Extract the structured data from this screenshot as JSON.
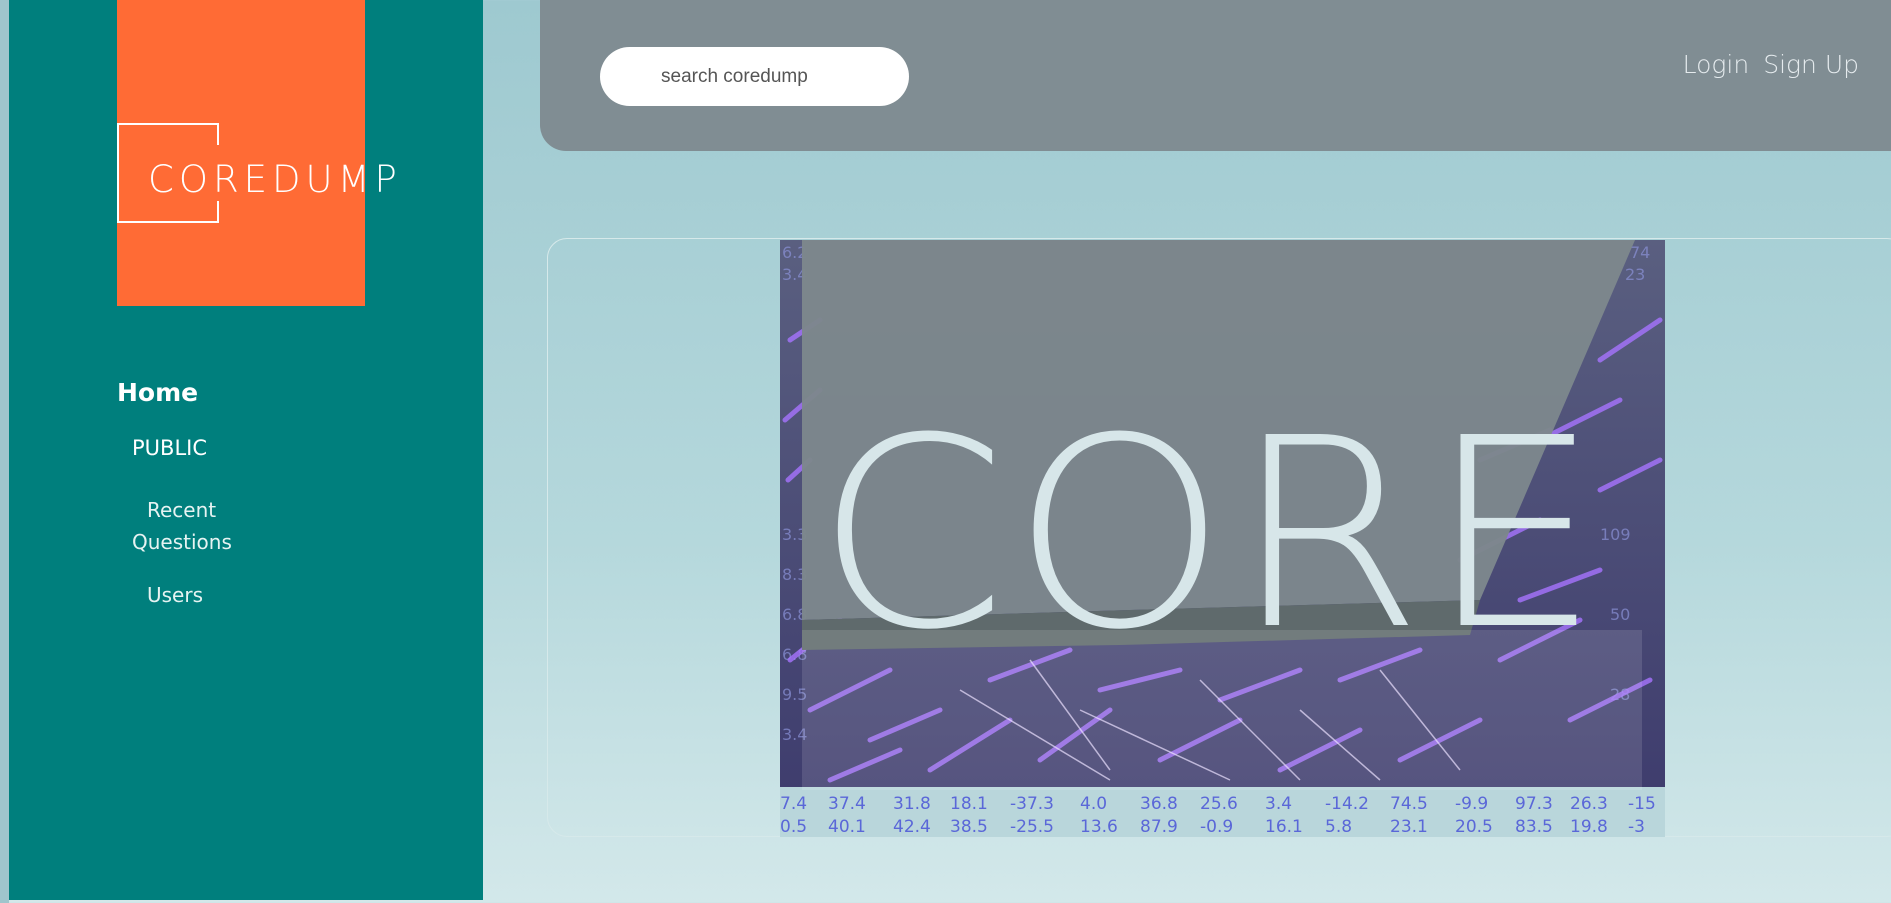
{
  "brand": {
    "logo_text": "COREDUMP"
  },
  "nav": {
    "home": "Home",
    "public": "PUBLIC",
    "recent_questions": "Recent Questions",
    "users": "Users"
  },
  "header": {
    "search_placeholder": "search coredump",
    "login": "Login",
    "signup": "Sign Up"
  },
  "banner": {
    "word": "CORE",
    "number_rows": [
      [
        "7.4",
        "37.4",
        "31.8",
        "18.1",
        "-37.3",
        "4.0",
        "36.8",
        "25.6",
        "3.4",
        "-14.2",
        "74.5",
        "-9.9",
        "97.3",
        "26.3",
        "-15"
      ],
      [
        "0.5",
        "40.1",
        "42.4",
        "38.5",
        "-25.5",
        "13.6",
        "87.9",
        "-0.9",
        "16.1",
        "5.8",
        "23.1",
        "20.5",
        "83.5",
        "19.8",
        "-3"
      ]
    ]
  },
  "colors": {
    "sidebar": "#007f7d",
    "logo_block": "#ff6b35",
    "header": "#808d93",
    "nav_text": "#ffffff"
  }
}
